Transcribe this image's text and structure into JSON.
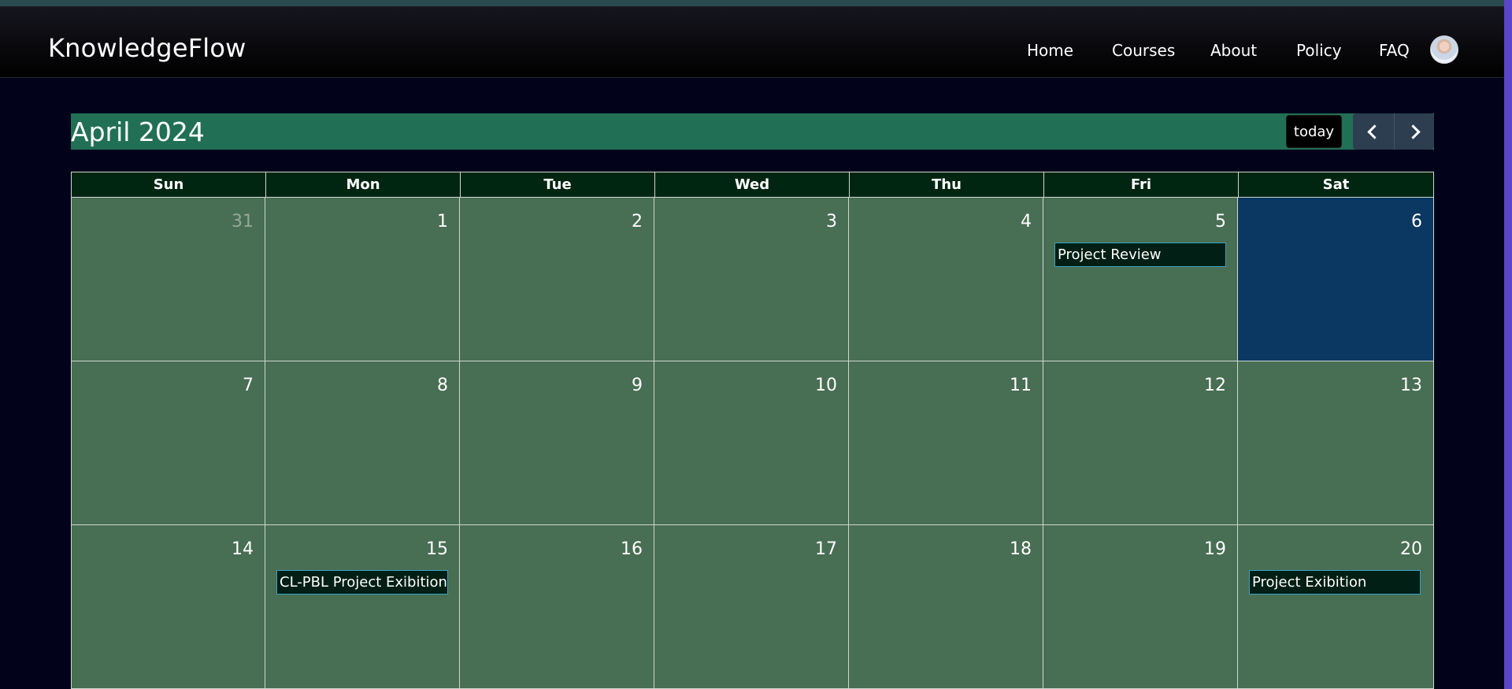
{
  "app": {
    "brand": "KnowledgeFlow"
  },
  "nav": {
    "links": [
      "Home",
      "Courses",
      "About",
      "Policy",
      "FAQ"
    ]
  },
  "calendar": {
    "title": "April 2024",
    "today_label": "today",
    "weekdays": [
      "Sun",
      "Mon",
      "Tue",
      "Wed",
      "Thu",
      "Fri",
      "Sat"
    ],
    "weeks": [
      [
        {
          "day": "31",
          "other_month": true
        },
        {
          "day": "1"
        },
        {
          "day": "2"
        },
        {
          "day": "3"
        },
        {
          "day": "4"
        },
        {
          "day": "5",
          "event": "Project Review"
        },
        {
          "day": "6",
          "today": true
        }
      ],
      [
        {
          "day": "7"
        },
        {
          "day": "8"
        },
        {
          "day": "9"
        },
        {
          "day": "10"
        },
        {
          "day": "11"
        },
        {
          "day": "12"
        },
        {
          "day": "13"
        }
      ],
      [
        {
          "day": "14"
        },
        {
          "day": "15",
          "event": "CL-PBL Project Exibition"
        },
        {
          "day": "16"
        },
        {
          "day": "17"
        },
        {
          "day": "18"
        },
        {
          "day": "19"
        },
        {
          "day": "20",
          "event": "Project Exibition"
        }
      ]
    ]
  },
  "colors": {
    "accent": "#217055",
    "cell": "#486e53",
    "today_cell": "#0b3862",
    "header_row": "#002612",
    "event_bg": "#011f14"
  }
}
